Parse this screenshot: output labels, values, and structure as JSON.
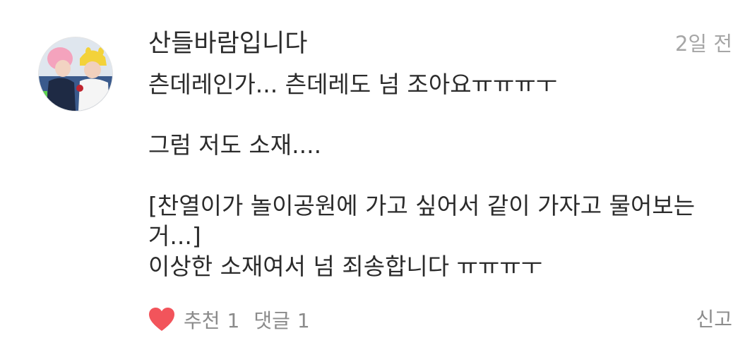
{
  "comment": {
    "author": "산들바람입니다",
    "time": "2일 전",
    "body_lines": [
      "츤데레인가... 츤데레도 넘 조아요ㅠㅠㅠㅜ",
      "",
      "그럼 저도 소재....",
      "",
      "[찬열이가 놀이공원에 가고 싶어서 같이 가자고 물어보는",
      "거...]",
      "이상한 소재여서 넘 죄송합니다 ㅠㅠㅠㅜ"
    ],
    "recommend_label": "추천",
    "recommend_count": "1",
    "reply_label": "댓글",
    "reply_count": "1",
    "report_label": "신고"
  },
  "colors": {
    "heart": "#f2545b",
    "meta_text": "#8b8b8b",
    "time_text": "#a6a6a6",
    "main_text": "#2b2b2b"
  },
  "icons": {
    "avatar": "profile-photo",
    "like": "heart-icon"
  }
}
